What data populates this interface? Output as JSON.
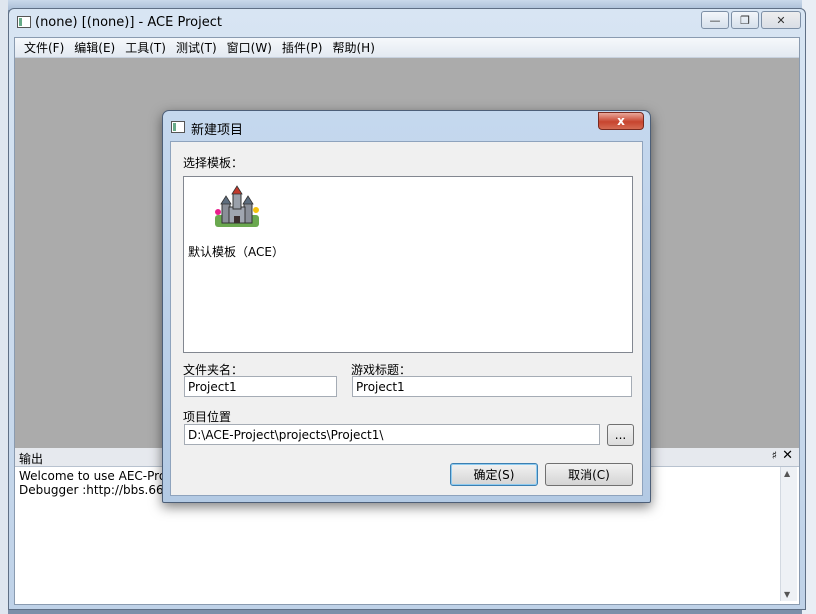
{
  "window": {
    "title": "(none) [(none)] - ACE Project",
    "minimize": "—",
    "restore": "❐",
    "close": "✕"
  },
  "menu": {
    "items": [
      "文件(F)",
      "编辑(E)",
      "工具(T)",
      "测试(T)",
      "窗口(W)",
      "插件(P)",
      "帮助(H)"
    ]
  },
  "output": {
    "title": "输出",
    "pin": "♯",
    "close": "✕",
    "lines": [
      "Welcome to use AEC-Proj",
      "Debugger :http://bbs.66r"
    ]
  },
  "dialog": {
    "title": "新建项目",
    "close": "x",
    "template_label": "选择模板：",
    "template_item": "默认模板（ACE）",
    "folder_label": "文件夹名：",
    "folder_value": "Project1",
    "game_title_label": "游戏标题：",
    "game_title_value": "Project1",
    "location_label": "项目位置",
    "location_value": "D:\\ACE-Project\\projects\\Project1\\",
    "browse": "...",
    "ok": "确定(S)",
    "cancel": "取消(C)"
  }
}
